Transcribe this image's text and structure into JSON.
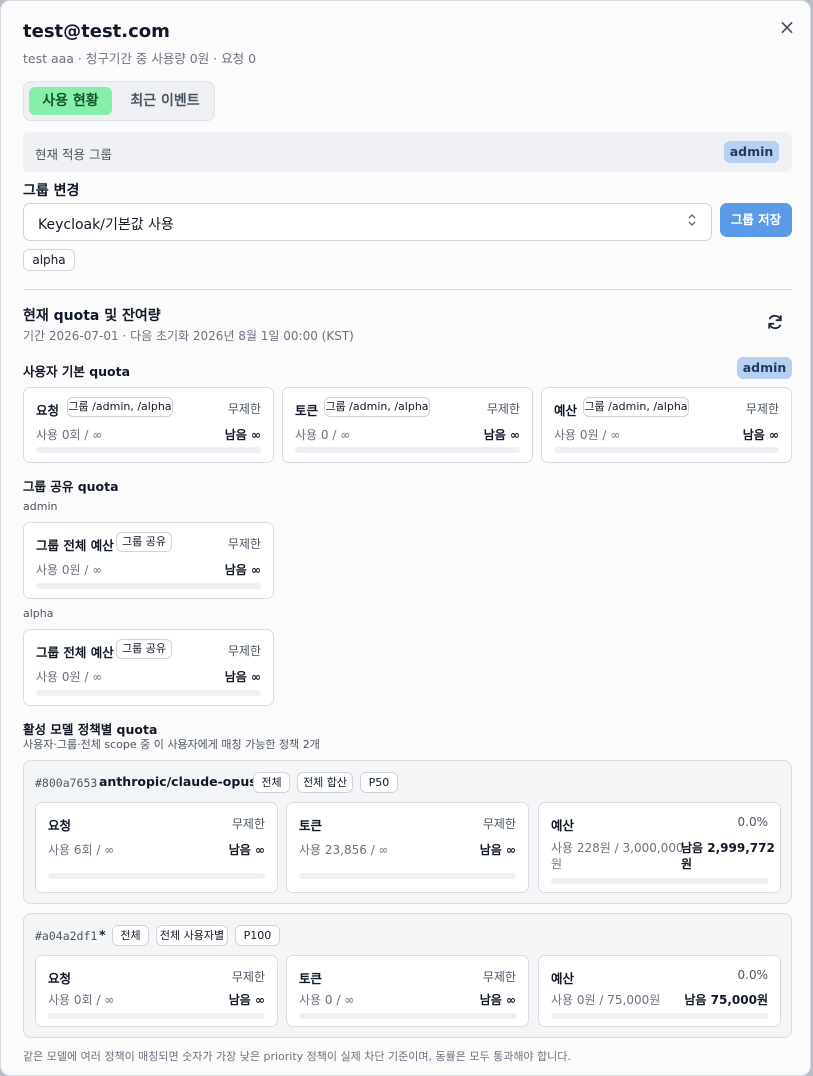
{
  "header": {
    "title": "test@test.com",
    "subtitle": "test aaa · 청구기간 중 사용량 0원 · 요청 0",
    "close_glyph": "×"
  },
  "tabs": [
    {
      "label": "사용 현황",
      "active": true
    },
    {
      "label": "최근 이벤트",
      "active": false
    }
  ],
  "current_group": {
    "label": "현재 적용 그룹",
    "value": "admin"
  },
  "group_change": {
    "heading": "그룹 변경",
    "select_value": "Keycloak/기본값 사용",
    "save_label": "그룹 저장",
    "chip": "alpha"
  },
  "quota": {
    "heading": "현재 quota 및 잔여량",
    "period": "기간 2026-07-01 · 다음 초기화 2026년 8월 1일 00:00 (KST)",
    "user_default": {
      "heading": "사용자 기본 quota",
      "badge": "admin",
      "cards": [
        {
          "label": "요청",
          "chip": "그룹 /admin, /alpha",
          "right": "무제한",
          "usage": "사용 0회 / ∞",
          "remain": "남음 ∞",
          "fill": 0
        },
        {
          "label": "토큰",
          "chip": "그룹 /admin, /alpha",
          "right": "무제한",
          "usage": "사용 0 / ∞",
          "remain": "남음 ∞",
          "fill": 0
        },
        {
          "label": "예산",
          "chip": "그룹 /admin, /alpha",
          "right": "무제한",
          "usage": "사용 0원 / ∞",
          "remain": "남음 ∞",
          "fill": 0
        }
      ]
    },
    "group_shared": {
      "heading": "그룹 공유 quota",
      "groups": [
        {
          "name": "admin",
          "card": {
            "label": "그룹 전체 예산",
            "chip": "그룹 공유",
            "right": "무제한",
            "usage": "사용 0원 / ∞",
            "remain": "남음 ∞",
            "fill": 0
          }
        },
        {
          "name": "alpha",
          "card": {
            "label": "그룹 전체 예산",
            "chip": "그룹 공유",
            "right": "무제한",
            "usage": "사용 0원 / ∞",
            "remain": "남음 ∞",
            "fill": 0
          }
        }
      ]
    },
    "policy": {
      "heading": "활성 모델 정책별 quota",
      "subheading": "사용자·그룹·전체 scope 중 이 사용자에게 매칭 가능한 정책 2개",
      "policies": [
        {
          "id": "#800a7653",
          "model": "anthropic/claude-opus-*",
          "chips": [
            "전체",
            "전체 합산",
            "P50"
          ],
          "cards": [
            {
              "label": "요청",
              "right": "무제한",
              "usage": "사용 6회 / ∞",
              "remain": "남음 ∞",
              "fill": 0
            },
            {
              "label": "토큰",
              "right": "무제한",
              "usage": "사용 23,856 / ∞",
              "remain": "남음 ∞",
              "fill": 0
            },
            {
              "label": "예산",
              "right": "0.0%",
              "usage_line1": "사용 228원 / 3,000,000",
              "usage_line2": "원",
              "remain_line1": "남음 2,999,772",
              "remain_line2": "원",
              "fill": 0.0001
            }
          ]
        },
        {
          "id": "#a04a2df1",
          "model": "*",
          "chips": [
            "전체",
            "전체 사용자별",
            "P100"
          ],
          "cards": [
            {
              "label": "요청",
              "right": "무제한",
              "usage": "사용 0회 / ∞",
              "remain": "남음 ∞",
              "fill": 0
            },
            {
              "label": "토큰",
              "right": "무제한",
              "usage": "사용 0 / ∞",
              "remain": "남음 ∞",
              "fill": 0
            },
            {
              "label": "예산",
              "right": "0.0%",
              "usage": "사용 0원 / 75,000원",
              "remain": "남음 75,000원",
              "fill": 0
            }
          ]
        }
      ]
    },
    "footer_note": "같은 모델에 여러 정책이 매칭되면 숫자가 가장 낮은 priority 정책이 실제 차단 기준이며, 동률은 모두 통과해야 합니다."
  },
  "colors": {
    "accent": "#5b9ae6",
    "tab_active": "#86efac",
    "badge": "#b8cff0"
  }
}
